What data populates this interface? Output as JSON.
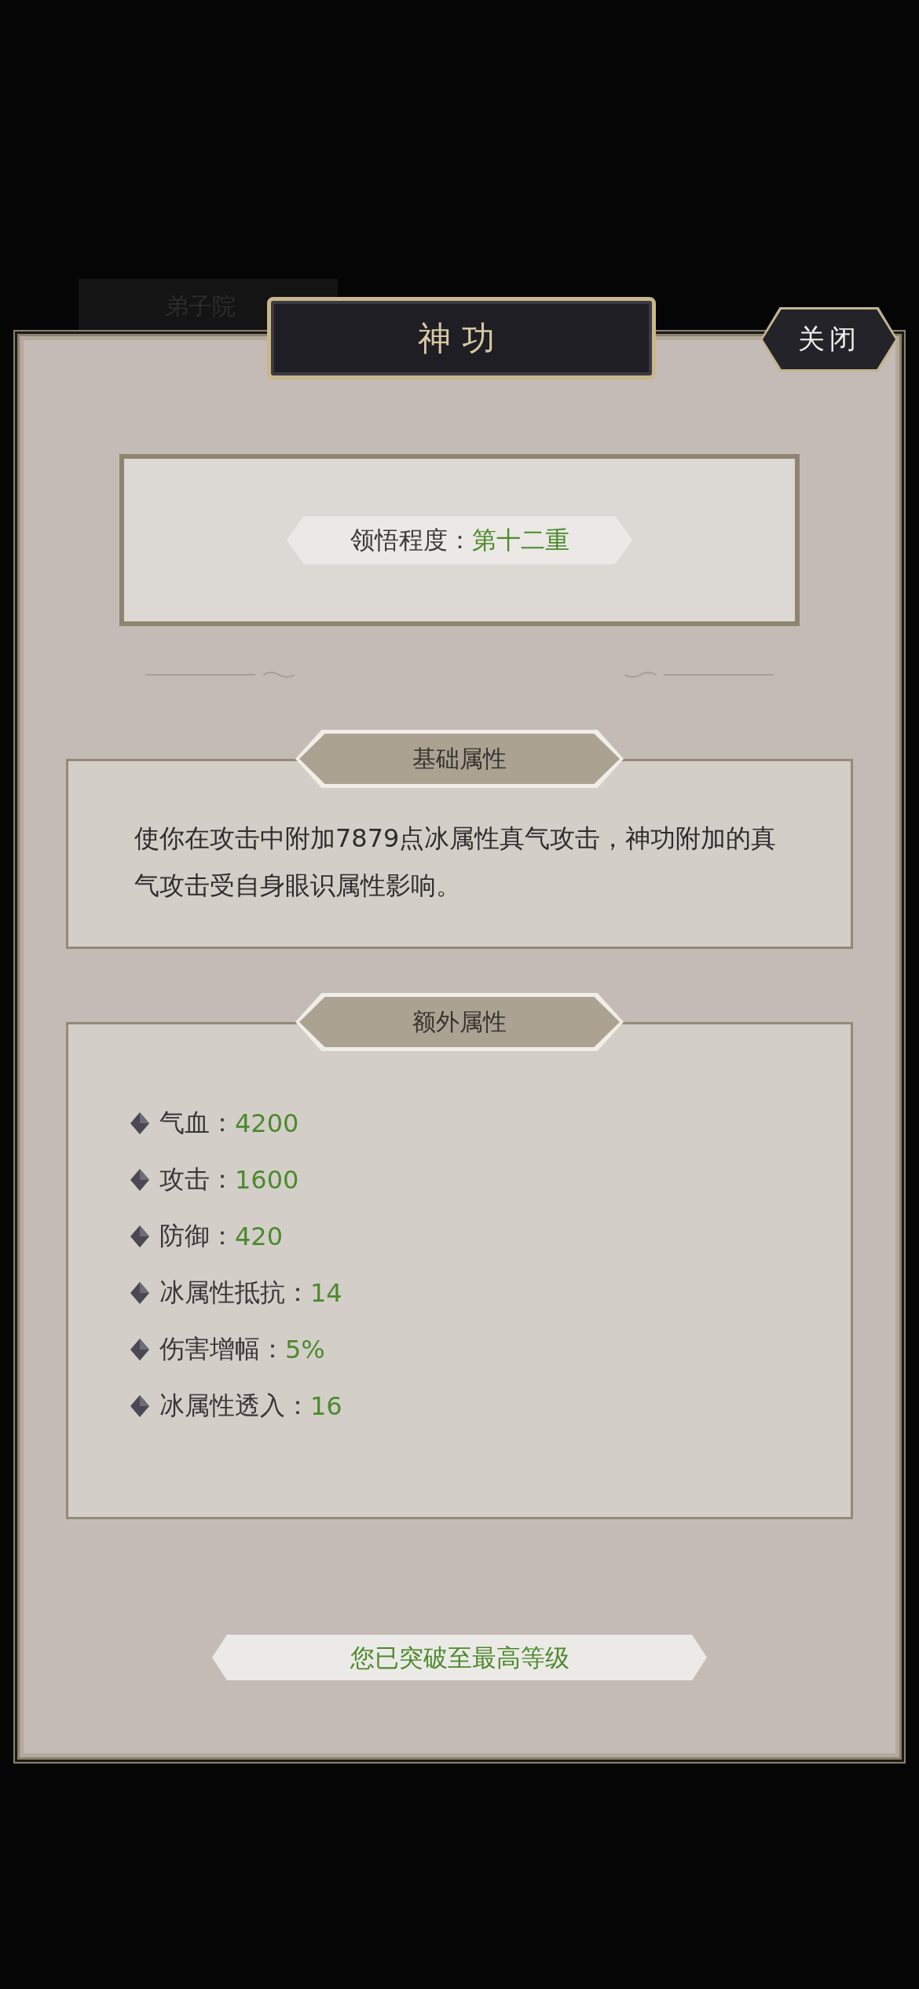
{
  "background": {
    "tab": "弟子院"
  },
  "dialog": {
    "title": "神功",
    "close_button": "关闭"
  },
  "comprehension": {
    "label": "领悟程度：",
    "value": "第十二重"
  },
  "sections": [
    {
      "kind": "text",
      "title": "基础属性",
      "text": "使你在攻击中附加7879点冰属性真气攻击，神功附加的真气攻击受自身眼识属性影响。"
    },
    {
      "kind": "stats",
      "title": "额外属性",
      "stats": [
        {
          "label": "气血：",
          "value": "4200"
        },
        {
          "label": "攻击：",
          "value": "1600"
        },
        {
          "label": "防御：",
          "value": "420"
        },
        {
          "label": "冰属性抵抗：",
          "value": "14"
        },
        {
          "label": "伤害增幅：",
          "value": "5%"
        },
        {
          "label": "冰属性透入：",
          "value": "16"
        }
      ]
    }
  ],
  "footer": "您已突破至最高等级"
}
